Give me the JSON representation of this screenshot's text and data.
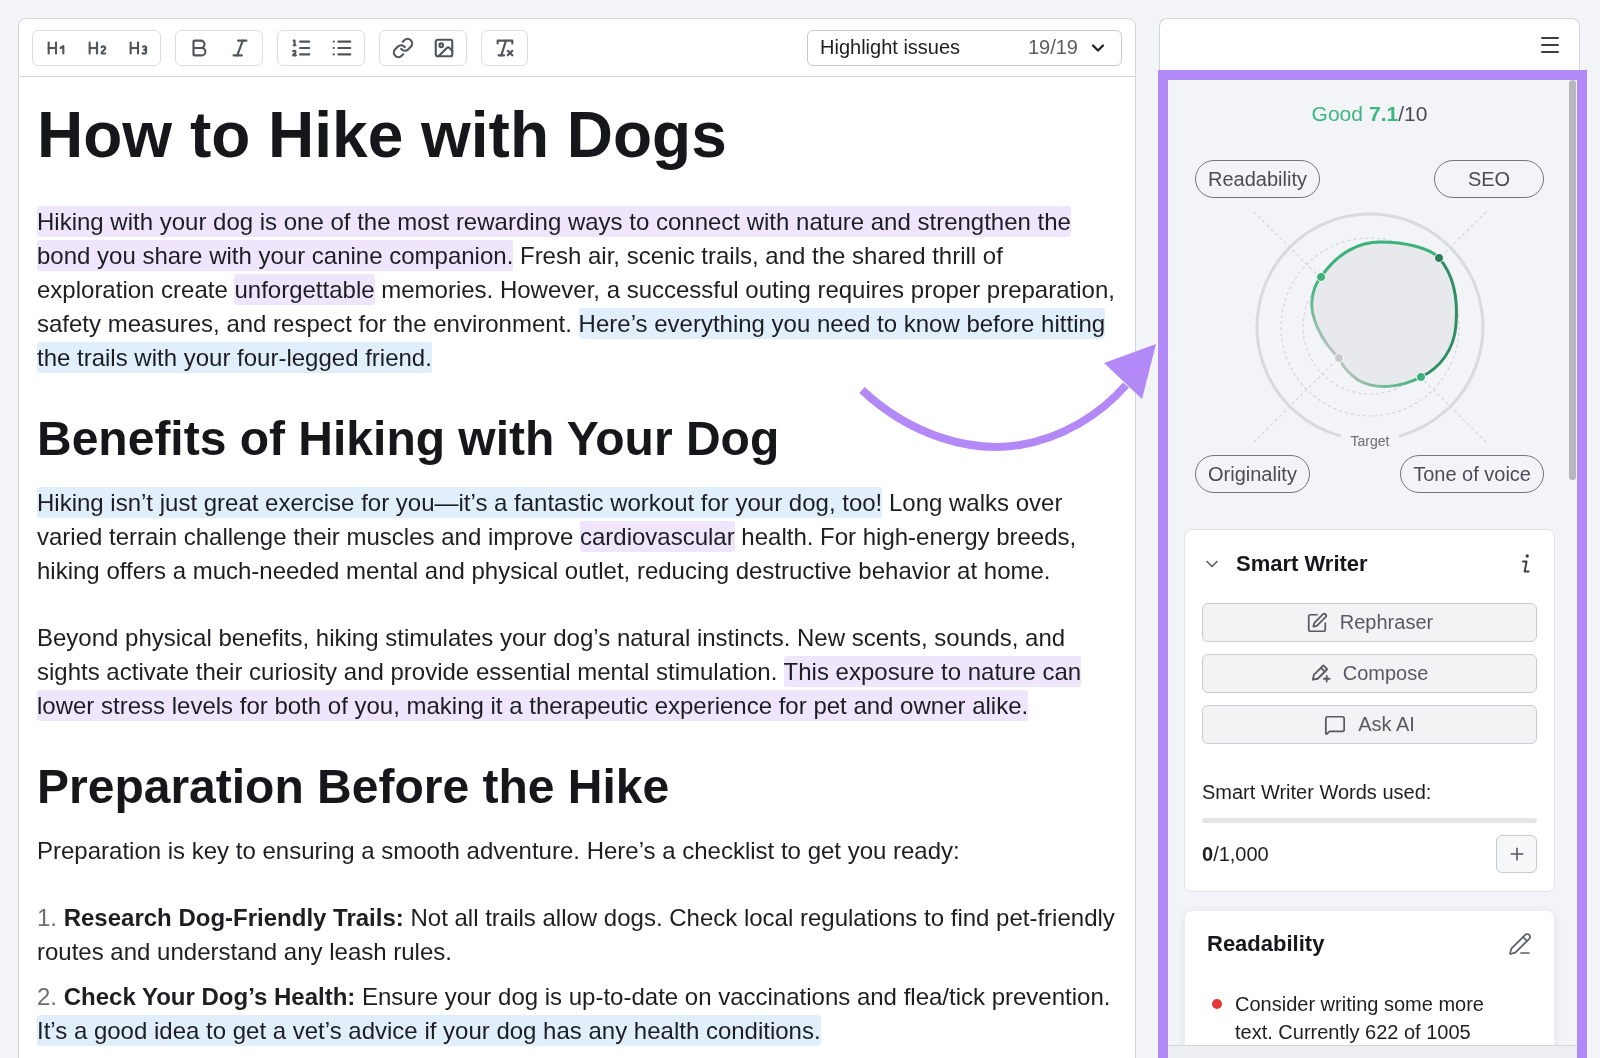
{
  "toolbar": {
    "groups": [
      {
        "buttons": [
          {
            "kind": "heading1"
          },
          {
            "kind": "heading2"
          },
          {
            "kind": "heading3"
          }
        ]
      },
      {
        "buttons": [
          {
            "kind": "bold"
          },
          {
            "kind": "italic"
          }
        ]
      },
      {
        "buttons": [
          {
            "kind": "numbered-list"
          },
          {
            "kind": "bulleted-list"
          }
        ]
      },
      {
        "buttons": [
          {
            "kind": "link"
          },
          {
            "kind": "image"
          }
        ]
      },
      {
        "buttons": [
          {
            "kind": "clear-formatting"
          }
        ]
      }
    ],
    "highlight_select": {
      "label": "Highlight issues",
      "count": "19/19"
    }
  },
  "document": {
    "blocks": [
      {
        "kind": "title",
        "text": "How to Hike with Dogs"
      },
      {
        "kind": "paragraph",
        "segments": [
          {
            "text": "Hiking with your dog is one of the most rewarding ways to connect with nature and strengthen the bond you share with your canine companion.",
            "color": "#efe5fd"
          },
          {
            "text": " Fresh air, scenic trails, and the shared thrill of exploration create "
          },
          {
            "text": "unforgettable",
            "color": "#efe5fd"
          },
          {
            "text": " memories. However, a successful outing requires proper preparation, safety measures, and respect for the environment. "
          },
          {
            "text": "Here’s everything you need to know before hitting the trails with your four-legged friend.",
            "color": "#e1effd"
          }
        ]
      },
      {
        "kind": "heading",
        "text": "Benefits of Hiking with Your Dog"
      },
      {
        "kind": "paragraph",
        "segments": [
          {
            "text": "Hiking isn’t just great exercise for you—it’s a fantastic workout for your dog, too!",
            "color": "#e1effd"
          },
          {
            "text": " Long walks over varied terrain challenge their muscles and improve "
          },
          {
            "text": "cardiovascular",
            "color": "#efe5fd"
          },
          {
            "text": " health. For high-energy breeds, hiking offers a much-needed mental and physical outlet, reducing destructive behavior at home."
          }
        ]
      },
      {
        "kind": "paragraph",
        "segments": [
          {
            "text": "Beyond physical benefits, hiking stimulates your dog’s natural instincts. New scents, sounds, and sights activate their curiosity and provide essential mental stimulation. "
          },
          {
            "text": "This exposure to nature can lower stress levels for both of you, making it a therapeutic experience for pet and owner alike.",
            "color": "#efe5fd"
          }
        ]
      },
      {
        "kind": "heading",
        "text": "Preparation Before the Hike"
      },
      {
        "kind": "paragraph",
        "segments": [
          {
            "text": "Preparation is key to ensuring a smooth adventure. Here’s a checklist to get you ready:"
          }
        ]
      },
      {
        "kind": "list_item",
        "number": "1.",
        "segments": [
          {
            "text": "**Research Dog-Friendly Trails:** Not all trails allow dogs. Check local regulations to find pet-friendly routes and understand any leash rules."
          }
        ]
      },
      {
        "kind": "list_item",
        "number": "2.",
        "segments": [
          {
            "text": "**Check Your Dog’s Health:** Ensure your dog is up-to-date on vaccinations and flea/tick prevention. "
          },
          {
            "text": "It’s a good idea to get a vet’s advice if your dog has any health conditions.",
            "color": "#e1effd"
          }
        ]
      }
    ]
  },
  "side_panel": {
    "score": {
      "rating": "Good",
      "value": "7.1",
      "out_of": "/10",
      "categories": [
        {
          "label": "Readability"
        },
        {
          "label": "SEO"
        },
        {
          "label": "Originality"
        },
        {
          "label": "Tone of voice"
        }
      ],
      "target_label": "Target"
    },
    "smart_writer": {
      "title": "Smart Writer",
      "expanded": true,
      "actions": [
        {
          "kind": "rephrase",
          "label": "Rephraser"
        },
        {
          "kind": "compose",
          "label": "Compose"
        },
        {
          "kind": "chat",
          "label": "Ask AI"
        }
      ],
      "usage": {
        "label": "Smart Writer Words used:",
        "level": 0,
        "used": "0",
        "limit": "/1,000"
      }
    },
    "readability": {
      "title": "Readability",
      "issues": [
        {
          "text": "Consider writing some more text. Currently 622 of 1005",
          "color": "#e5383b"
        }
      ]
    }
  }
}
